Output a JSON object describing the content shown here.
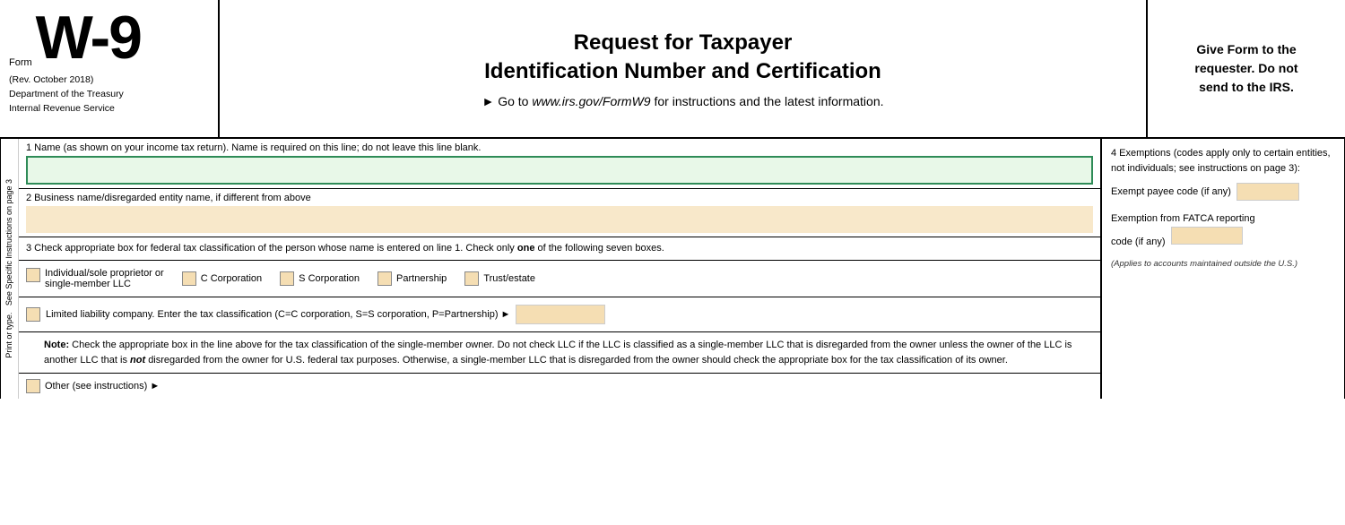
{
  "header": {
    "form_label": "Form",
    "form_number": "W-9",
    "rev_date": "(Rev. October 2018)",
    "dept": "Department of the Treasury",
    "service": "Internal Revenue Service",
    "title_line1": "Request for Taxpayer",
    "title_line2": "Identification Number and Certification",
    "subtitle": "► Go to www.irs.gov/FormW9 for instructions and the latest information.",
    "subtitle_italic": "www.irs.gov/FormW9",
    "right_text_line1": "Give Form to the",
    "right_text_line2": "requester. Do not",
    "right_text_line3": "send to the IRS."
  },
  "side_labels": {
    "line1": "Print or type.",
    "line2": "See Specific Instructions on page 3"
  },
  "fields": {
    "line1_label": "1  Name (as shown on your income tax return). Name is required on this line; do not leave this line blank.",
    "line2_label": "2  Business name/disregarded entity name, if different from above",
    "section3_label": "3  Check appropriate box for federal tax classification of the person whose name is entered on line 1. Check only",
    "section3_label_bold": "one",
    "section3_label2": "of the following seven boxes.",
    "section4_label": "4  Exemptions (codes apply only to certain entities, not individuals; see instructions on page 3):",
    "checkboxes": [
      {
        "id": "indiv",
        "label_line1": "Individual/sole proprietor or",
        "label_line2": "single-member LLC"
      },
      {
        "id": "ccorp",
        "label": "C Corporation"
      },
      {
        "id": "scorp",
        "label": "S Corporation"
      },
      {
        "id": "partner",
        "label": "Partnership"
      },
      {
        "id": "trust",
        "label": "Trust/estate"
      }
    ],
    "llc_label": "Limited liability company. Enter the tax classification (C=C corporation, S=S corporation, P=Partnership) ►",
    "note_bold": "Note:",
    "note_text": " Check the appropriate box in the line above for the tax classification of the single-member owner.  Do not check LLC if the LLC is classified as a single-member LLC that is disregarded from the owner unless the owner of the LLC is another LLC that is ",
    "note_not_bold": "not",
    "note_text2": " disregarded from the owner for U.S. federal tax purposes. Otherwise, a single-member LLC that is disregarded from the owner should check the appropriate box for the tax classification of its owner.",
    "other_label": "Other (see instructions) ►",
    "exempt_payee_label": "Exempt payee code (if any)",
    "fatca_label_line1": "Exemption from FATCA reporting",
    "fatca_label_line2": "code (if any)",
    "applies_note": "(Applies to accounts maintained outside the U.S.)"
  }
}
